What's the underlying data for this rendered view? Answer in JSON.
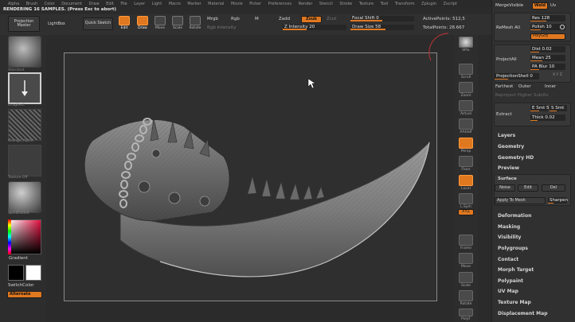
{
  "menu": [
    "Alpha",
    "Brush",
    "Color",
    "Document",
    "Draw",
    "Edit",
    "File",
    "Layer",
    "Light",
    "Macro",
    "Marker",
    "Material",
    "Movie",
    "Picker",
    "Preferences",
    "Render",
    "Stencil",
    "Stroke",
    "Texture",
    "Tool",
    "Transform",
    "Zplugin",
    "Zscript"
  ],
  "status": "RENDERING 16 SAMPLES. (Press Esc to abort)",
  "toolbar": {
    "projection_master": "Projection Master",
    "lightbox": "LightBox",
    "quick_sketch": "Quick Sketch",
    "edit": "Edit",
    "draw": "Draw",
    "move": "Move",
    "scale": "Scale",
    "rotate": "Rotate",
    "mrgb": "Mrgb",
    "rgb": "Rgb",
    "m": "M",
    "rgb_intensity": "Rgb Intensity",
    "zadd": "Zadd",
    "zsub": "Zsub",
    "zcut": "Zcut",
    "z_intensity": "Z Intensity 20",
    "focal_shift": "Focal Shift 0",
    "draw_size": "Draw Size 58",
    "active_points": "ActivePoints: 512,5",
    "total_points": "TotalPoints: 28.667"
  },
  "left_shelf": {
    "thumbs": [
      "Standard",
      "DragRect",
      "Grunge_Alpha",
      "Texture Off",
      "SkinShade4"
    ],
    "gradient": "Gradient",
    "switch_color": "SwitchColor",
    "alternate": "Alternate"
  },
  "right_tools": [
    "SPix",
    "Scroll",
    "Zoom",
    "Actual",
    "AAHalf",
    "Persp",
    "Floor",
    "Local",
    "L.Sym",
    "XYZ",
    "Frame",
    "Move",
    "Scale",
    "Rotate",
    "PolyF"
  ],
  "right_panel": {
    "merge_visible": "MergeVisible",
    "weld": "Weld",
    "uv": "Uv",
    "remesh_all": "ReMesh All",
    "res": "Res 128",
    "polish": "Polish 10",
    "polygrp": "PolyGrp",
    "project_all": "ProjectAll",
    "dist": "Dist 0.02",
    "mean": "Mean 25",
    "pa_blur": "PA Blur 10",
    "projection_shell": "ProjectionShell 0",
    "xyz": "X Y Z",
    "farthest": "Farthest",
    "outer": "Outer",
    "inner": "Inner",
    "reproject": "Reproject Higher Subdiv",
    "extract": "Extract",
    "e_smt": "E Smt 5",
    "s_smt": "S Smt",
    "thick": "Thick 0.02",
    "layers": "Layers",
    "geometry": "Geometry",
    "geometry_hd": "Geometry HD",
    "preview": "Preview",
    "surface": "Surface",
    "noise": "Noise",
    "edit": "Edit",
    "del": "Del",
    "apply_to_mesh": "Apply To Mesh",
    "sharpen": "Sharpen",
    "menus": [
      "Deformation",
      "Masking",
      "Visibility",
      "Polygroups",
      "Contact",
      "Morph Target",
      "Polypaint",
      "UV Map",
      "Texture Map",
      "Displacement Map"
    ]
  },
  "colors": {
    "accent": "#e07820",
    "bg": "#2b2b2b",
    "panel": "#303030",
    "mesh": "#8c8c8c"
  }
}
